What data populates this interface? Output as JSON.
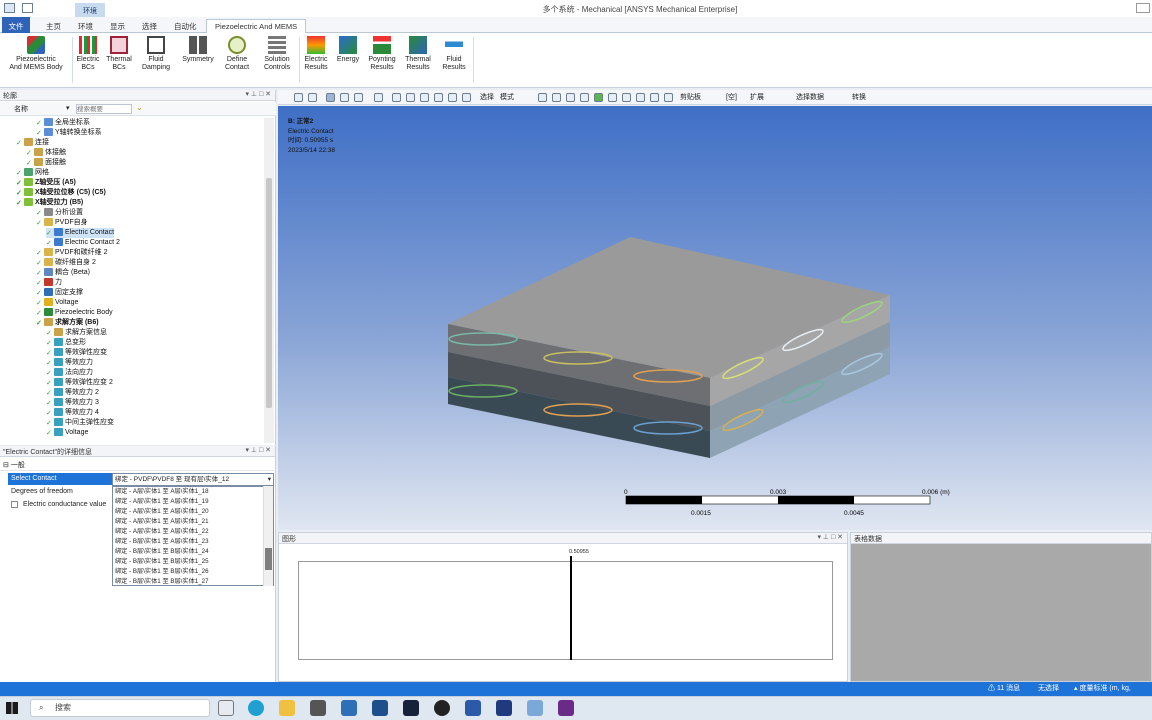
{
  "window": {
    "title": "多个系统 - Mechanical [ANSYS Mechanical Enterprise]",
    "context_tab": "环境"
  },
  "ribbon_tabs": [
    "文件",
    "主页",
    "环境",
    "显示",
    "选择",
    "自动化",
    "Piezoelectric And MEMS"
  ],
  "ribbon_buttons": [
    {
      "label": "Piezoelectric\nAnd MEMS Body",
      "icon": "piezo-body-icon"
    },
    {
      "label": "Electric\nBCs",
      "icon": "electric-bcs-icon"
    },
    {
      "label": "Thermal\nBCs",
      "icon": "thermal-bcs-icon"
    },
    {
      "label": "Fluid\nDamping",
      "icon": "fluid-damping-icon"
    },
    {
      "label": "Symmetry",
      "icon": "symmetry-icon"
    },
    {
      "label": "Define\nContact",
      "icon": "define-contact-icon"
    },
    {
      "label": "Solution\nControls",
      "icon": "solution-controls-icon"
    },
    {
      "label": "Electric\nResults",
      "icon": "electric-results-icon"
    },
    {
      "label": "Energy",
      "icon": "energy-icon"
    },
    {
      "label": "Poynting\nResults",
      "icon": "poynting-icon"
    },
    {
      "label": "Thermal\nResults",
      "icon": "thermal-results-icon"
    },
    {
      "label": "Fluid\nResults",
      "icon": "fluid-results-icon"
    }
  ],
  "outline": {
    "title": "轮廓",
    "name_label": "名称",
    "search_placeholder": "搜索概要",
    "tree": [
      {
        "label": "全局坐标系",
        "indent": 4,
        "icon": "#5b8ed6"
      },
      {
        "label": "Y轴转换坐标系",
        "indent": 4,
        "icon": "#5b8ed6"
      },
      {
        "label": "连接",
        "indent": 2,
        "icon": "#c9a34a"
      },
      {
        "label": "体接触",
        "indent": 3,
        "icon": "#c9a34a"
      },
      {
        "label": "面接触",
        "indent": 3,
        "icon": "#c9a34a"
      },
      {
        "label": "网格",
        "indent": 2,
        "icon": "#4aa36b"
      },
      {
        "label": "Z轴受压 (A5)",
        "indent": 2,
        "icon": "#7fbf3a",
        "bold": true
      },
      {
        "label": "X轴受拉位移 (C5) (C5)",
        "indent": 2,
        "icon": "#7fbf3a",
        "bold": true
      },
      {
        "label": "X轴受拉力 (B5)",
        "indent": 2,
        "icon": "#7fbf3a",
        "bold": true
      },
      {
        "label": "分析设置",
        "indent": 4,
        "icon": "#8a8a8a"
      },
      {
        "label": "PVDF自身",
        "indent": 4,
        "icon": "#d9b44a"
      },
      {
        "label": "Electric Contact",
        "indent": 5,
        "icon": "#3b7bd0",
        "selected": true
      },
      {
        "label": "Electric Contact 2",
        "indent": 5,
        "icon": "#3b7bd0"
      },
      {
        "label": "PVDF和碳纤维 2",
        "indent": 4,
        "icon": "#d9b44a"
      },
      {
        "label": "碳纤维自身 2",
        "indent": 4,
        "icon": "#d9b44a"
      },
      {
        "label": "耦合 (Beta)",
        "indent": 4,
        "icon": "#5f88c2"
      },
      {
        "label": "力",
        "indent": 4,
        "icon": "#c0392b"
      },
      {
        "label": "固定支撑",
        "indent": 4,
        "icon": "#2f6db5"
      },
      {
        "label": "Voltage",
        "indent": 4,
        "icon": "#e0b020"
      },
      {
        "label": "Piezoelectric Body",
        "indent": 4,
        "icon": "#2c8c3c"
      },
      {
        "label": "求解方案 (B6)",
        "indent": 4,
        "icon": "#c9a34a",
        "bold": true
      },
      {
        "label": "求解方案信息",
        "indent": 5,
        "icon": "#c9a34a"
      },
      {
        "label": "总变形",
        "indent": 5,
        "icon": "#3aa0c0"
      },
      {
        "label": "等效弹性应变",
        "indent": 5,
        "icon": "#3aa0c0"
      },
      {
        "label": "等效应力",
        "indent": 5,
        "icon": "#3aa0c0"
      },
      {
        "label": "法向应力",
        "indent": 5,
        "icon": "#3aa0c0"
      },
      {
        "label": "等效弹性应变 2",
        "indent": 5,
        "icon": "#3aa0c0"
      },
      {
        "label": "等效应力 2",
        "indent": 5,
        "icon": "#3aa0c0"
      },
      {
        "label": "等效应力 3",
        "indent": 5,
        "icon": "#3aa0c0"
      },
      {
        "label": "等效应力 4",
        "indent": 5,
        "icon": "#3aa0c0"
      },
      {
        "label": "中间主弹性应变",
        "indent": 5,
        "icon": "#3aa0c0"
      },
      {
        "label": "Voltage",
        "indent": 5,
        "icon": "#3aa0c0"
      }
    ]
  },
  "details": {
    "title": "\"Electric Contact\"的详细信息",
    "group": "一般",
    "rows": [
      {
        "label": "Select Contact",
        "selected": true
      },
      {
        "label": "Degrees of freedom"
      },
      {
        "label": "Electric conductance value"
      }
    ],
    "dropdown_value": "绑定 - PVDF\\PVDF8 至 现有层\\实体_12",
    "options": [
      "绑定 - A层\\实体1 至 A层\\实体1_18",
      "绑定 - A层\\实体1 至 A层\\实体1_19",
      "绑定 - A层\\实体1 至 A层\\实体1_20",
      "绑定 - A层\\实体1 至 A层\\实体1_21",
      "绑定 - A层\\实体1 至 A层\\实体1_22",
      "绑定 - B层\\实体1 至 A层\\实体1_23",
      "绑定 - B层\\实体1 至 B层\\实体1_24",
      "绑定 - B层\\实体1 至 B层\\实体1_25",
      "绑定 - B层\\实体1 至 B层\\实体1_26",
      "绑定 - B层\\实体1 至 B层\\实体1_27"
    ]
  },
  "graphics_toolbar": {
    "select": "选择",
    "mode": "模式",
    "clipboard": "剪贴板",
    "empty": "[空]",
    "extend": "扩展",
    "select_data": "选择数据",
    "convert": "转换"
  },
  "viewport": {
    "info": [
      "B: 正常2",
      "Electric Contact",
      "时间: 0.50955 s",
      "2023/5/14 22:38"
    ],
    "scale": {
      "ticks_top": [
        "0",
        "0.003",
        "0.006 (m)"
      ],
      "ticks_bottom": [
        "0.0015",
        "0.0045"
      ]
    }
  },
  "graph": {
    "title": "图形",
    "marker": "0.50955"
  },
  "table_data": {
    "title": "表格数据"
  },
  "statusbar": {
    "messages": "11 消息",
    "selection": "无选择",
    "units": "度量标准 (m, kg,"
  },
  "taskbar": {
    "search": "搜索"
  },
  "colors": {
    "accent": "#1e73d8",
    "ribbon_file": "#2e63b7",
    "selection": "#cfe3f8"
  }
}
